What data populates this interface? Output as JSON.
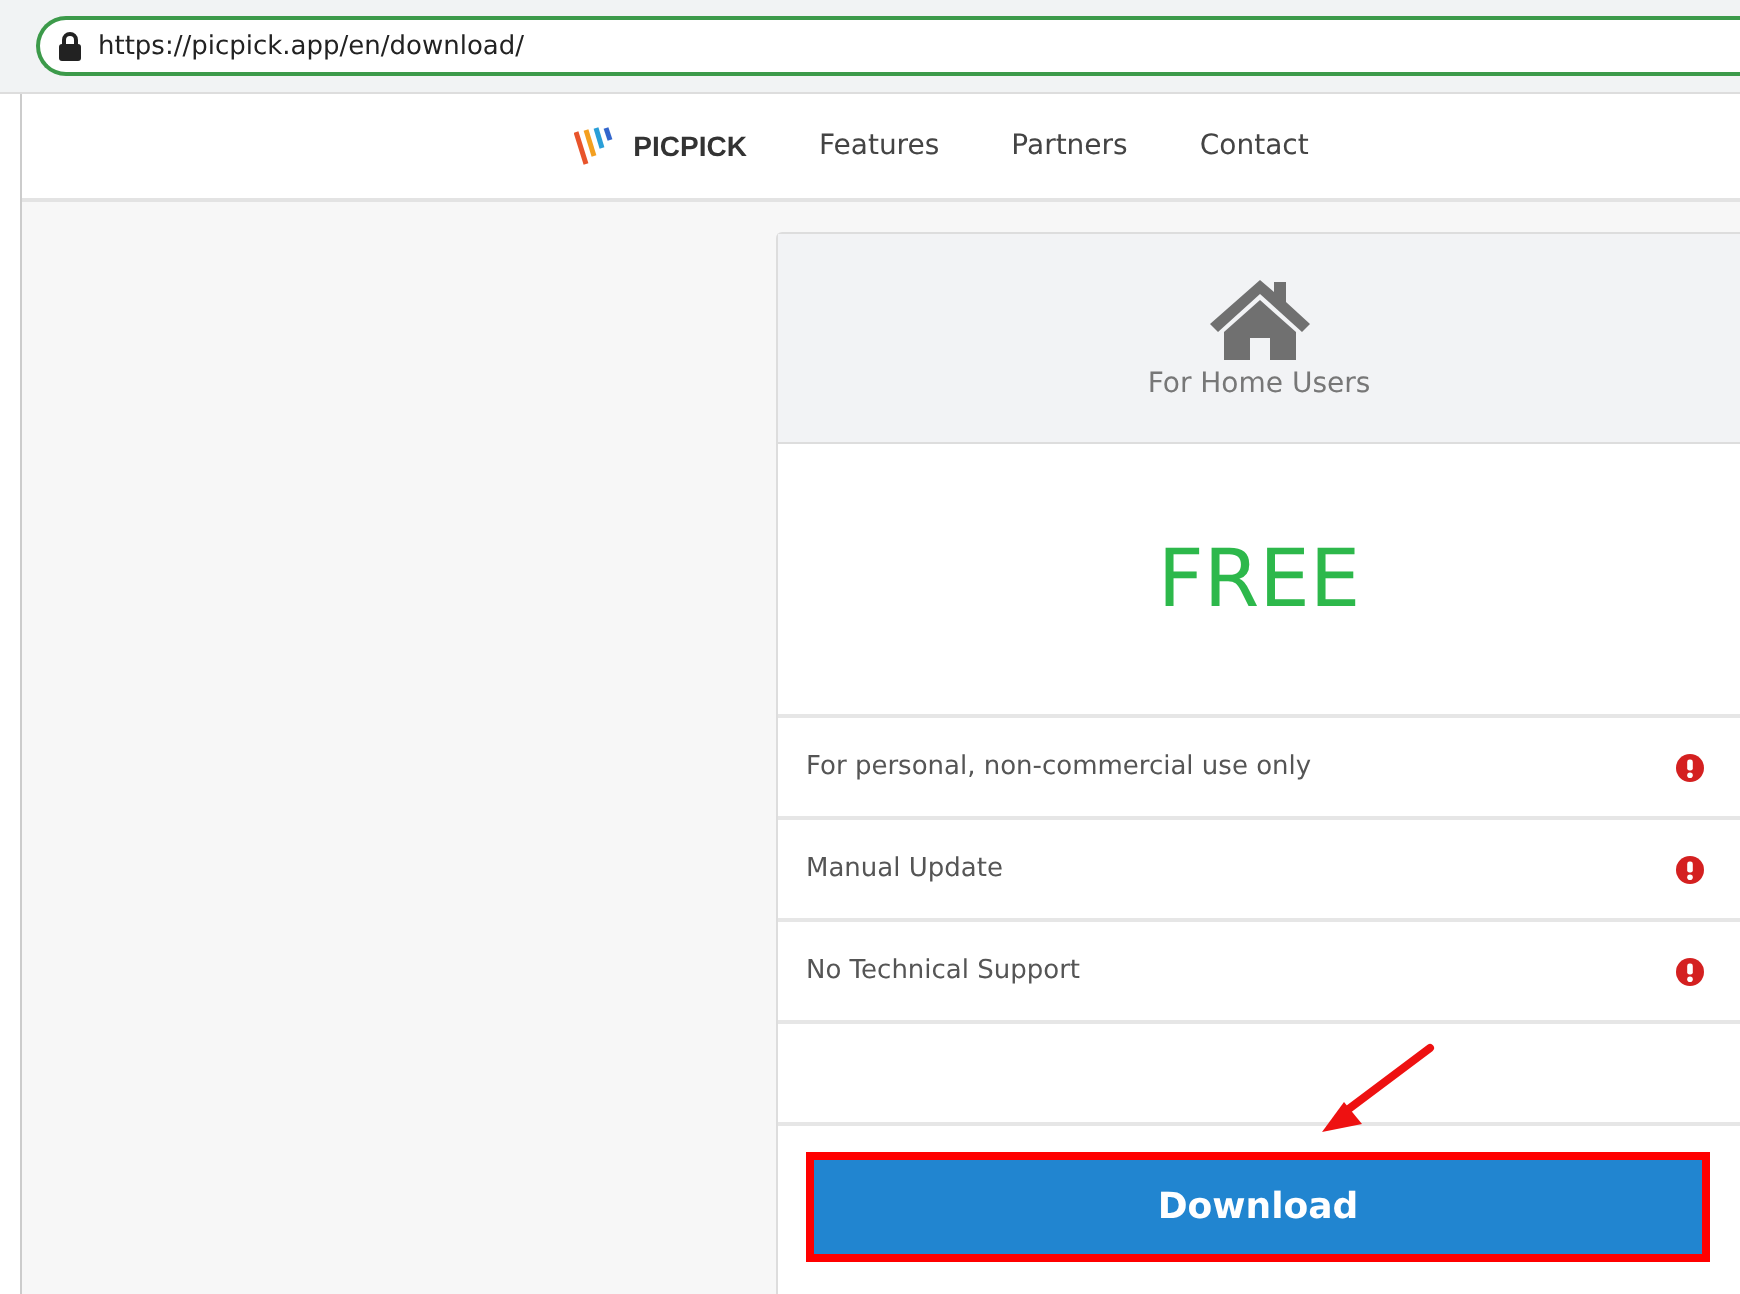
{
  "address_bar": {
    "url": "https://picpick.app/en/download/"
  },
  "nav": {
    "brand": "PICPICK",
    "links": [
      "Features",
      "Partners",
      "Contact"
    ]
  },
  "plan": {
    "title": "For Home Users",
    "price": "FREE",
    "features": [
      {
        "text": "For personal, non-commercial use only",
        "kind": "warning"
      },
      {
        "text": "Manual Update",
        "kind": "warning"
      },
      {
        "text": "No Technical Support",
        "kind": "warning"
      }
    ],
    "download_button": {
      "label": "Download",
      "highlighted": true
    }
  }
}
